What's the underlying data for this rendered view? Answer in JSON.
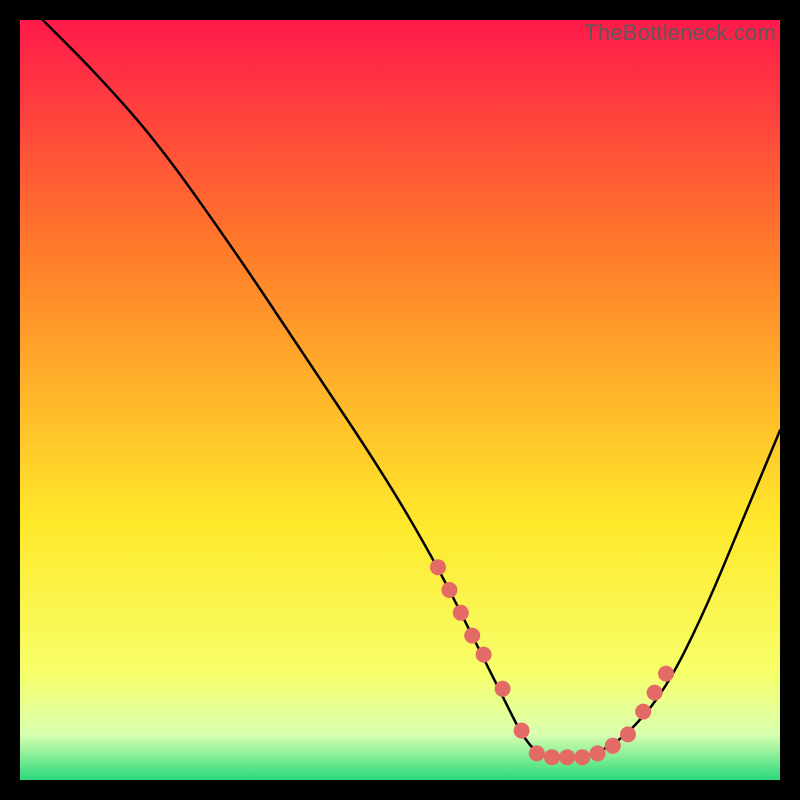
{
  "watermark": "TheBottleneck.com",
  "colors": {
    "bg": "#000000",
    "curve": "#000000",
    "dot": "#e46a66",
    "grad_top": "#ff1a4b",
    "grad_mid1": "#ff7a2a",
    "grad_mid2": "#ffe82a",
    "grad_low1": "#f7ff6a",
    "grad_low2": "#d9ffb0",
    "grad_bottom": "#2bd97c"
  },
  "chart_data": {
    "type": "line",
    "title": "",
    "xlabel": "",
    "ylabel": "",
    "xlim": [
      0,
      100
    ],
    "ylim": [
      0,
      100
    ],
    "series": [
      {
        "name": "bottleneck-curve",
        "x": [
          3,
          10,
          18,
          28,
          38,
          48,
          55,
          60,
          64,
          66,
          68,
          70,
          73,
          76,
          80,
          85,
          90,
          95,
          100
        ],
        "y": [
          100,
          93,
          84,
          70,
          55,
          40,
          28,
          18,
          10,
          6,
          3.5,
          3,
          3,
          3.5,
          6,
          12,
          22,
          34,
          46
        ]
      }
    ],
    "dots": {
      "name": "sample-points",
      "x": [
        55,
        56.5,
        58,
        59.5,
        61,
        63.5,
        66,
        68,
        70,
        72,
        74,
        76,
        78,
        80,
        82,
        83.5,
        85
      ],
      "y": [
        28,
        25,
        22,
        19,
        16.5,
        12,
        6.5,
        3.5,
        3,
        3,
        3,
        3.5,
        4.5,
        6,
        9,
        11.5,
        14
      ]
    }
  }
}
